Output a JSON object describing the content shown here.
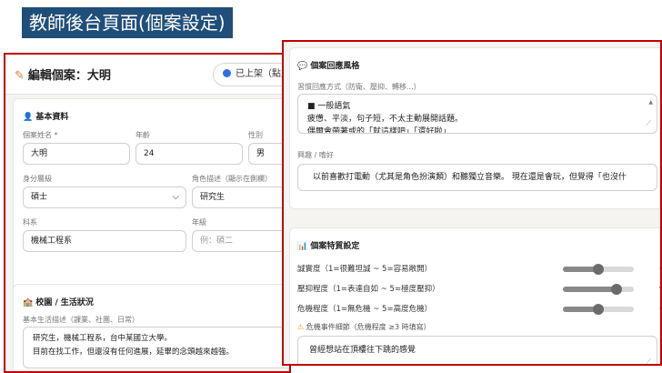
{
  "page_title": "教師後台頁面(個案設定)",
  "left": {
    "header_title": "編輯個案：大明",
    "status_label": "已上架（點此",
    "basic": {
      "title": "基本資料",
      "name_label": "個案姓名 *",
      "name_value": "大明",
      "age_label": "年齡",
      "age_value": "24",
      "gender_label": "性別",
      "gender_value": "男",
      "identity_label": "身分層級",
      "identity_value": "碩士",
      "role_label": "角色描述（顯示在側欄）",
      "role_value": "研究生",
      "dept_label": "科系",
      "dept_value": "機械工程系",
      "grade_label": "年級",
      "grade_placeholder": "例：碩二"
    },
    "campus": {
      "title": "校園 / 生活狀況",
      "desc_label": "基本生活描述（課業、社團、日常）",
      "desc_line1": "研究生，機械工程系，台中某國立大學。",
      "desc_line2": "目前在找工作，但還沒有任何進展，延畢的念頭越來越強。"
    }
  },
  "right": {
    "style": {
      "title": "個案回應風格",
      "habit_label": "習慣回應方式（防衛、壓抑、轉移...）",
      "habit_line1": "■ 一般語氣",
      "habit_line2": "疲憊、平淡，句子短，不太主動展開話題。",
      "habit_line3": "偶爾會帶著或的「就這樣吧」「還好啦」",
      "hobby_label": "興趣 / 嗜好",
      "hobby_value": "以前喜歡打電動（尤其是角色扮演類）和聽獨立音樂。 現在還是會玩，但覺得「也沒什"
    },
    "traits": {
      "title": "個案特質設定",
      "sliders": [
        {
          "label": "誠實度（1=很難坦誠 ~ 5=容易敞開）",
          "value": 3,
          "fraction": 0.5
        },
        {
          "label": "壓抑程度（1=表達自如 ~ 5=極度壓抑）",
          "value": 4,
          "fraction": 0.75
        },
        {
          "label": "危機程度（1=無危機 ~ 5=高度危機）",
          "value": 3,
          "fraction": 0.5
        }
      ],
      "crisis_label": "危機事件細節（危機程度 ≥3  時填寫）",
      "crisis_value": "曾經想站在頂樓往下跳的感覺"
    }
  },
  "colors": {
    "banner": "#1f4e79",
    "highlight_border": "#c00000",
    "status_dot": "#2e6fe0",
    "pencil": "#d9822b",
    "warning": "#e0a020"
  }
}
